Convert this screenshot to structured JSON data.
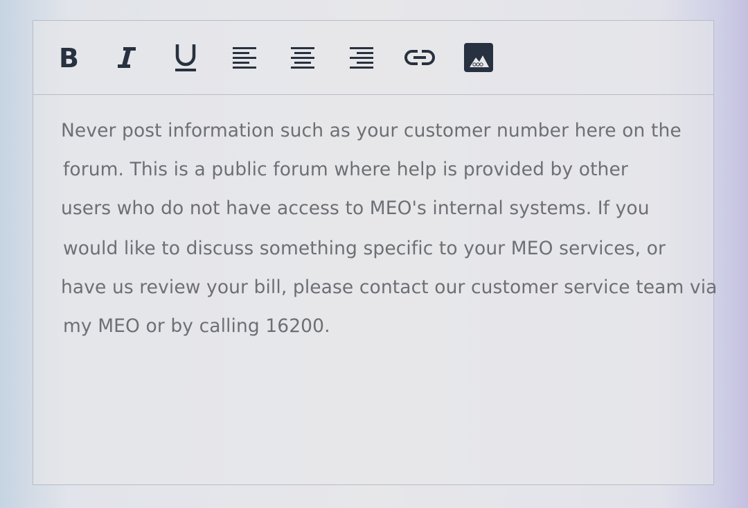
{
  "toolbar": {
    "buttons": [
      {
        "name": "bold-button",
        "icon": "bold-icon"
      },
      {
        "name": "italic-button",
        "icon": "italic-icon"
      },
      {
        "name": "underline-button",
        "icon": "underline-icon"
      },
      {
        "name": "align-left-button",
        "icon": "align-left-icon"
      },
      {
        "name": "align-center-button",
        "icon": "align-center-icon"
      },
      {
        "name": "align-right-button",
        "icon": "align-right-icon"
      },
      {
        "name": "insert-link-button",
        "icon": "link-icon"
      },
      {
        "name": "insert-image-button",
        "icon": "image-icon"
      }
    ],
    "icon_color": "#27313f"
  },
  "content": {
    "lines": [
      "Never post information such as your customer number here on the",
      "forum. This is a public forum where help is provided by other",
      "users who do not have access to MEO's internal systems. If you",
      "would like to discuss something specific to your MEO services, or",
      "have us review your bill, please contact our customer service team via",
      "my MEO or by calling 16200."
    ],
    "text_color": "#6c6f74"
  }
}
